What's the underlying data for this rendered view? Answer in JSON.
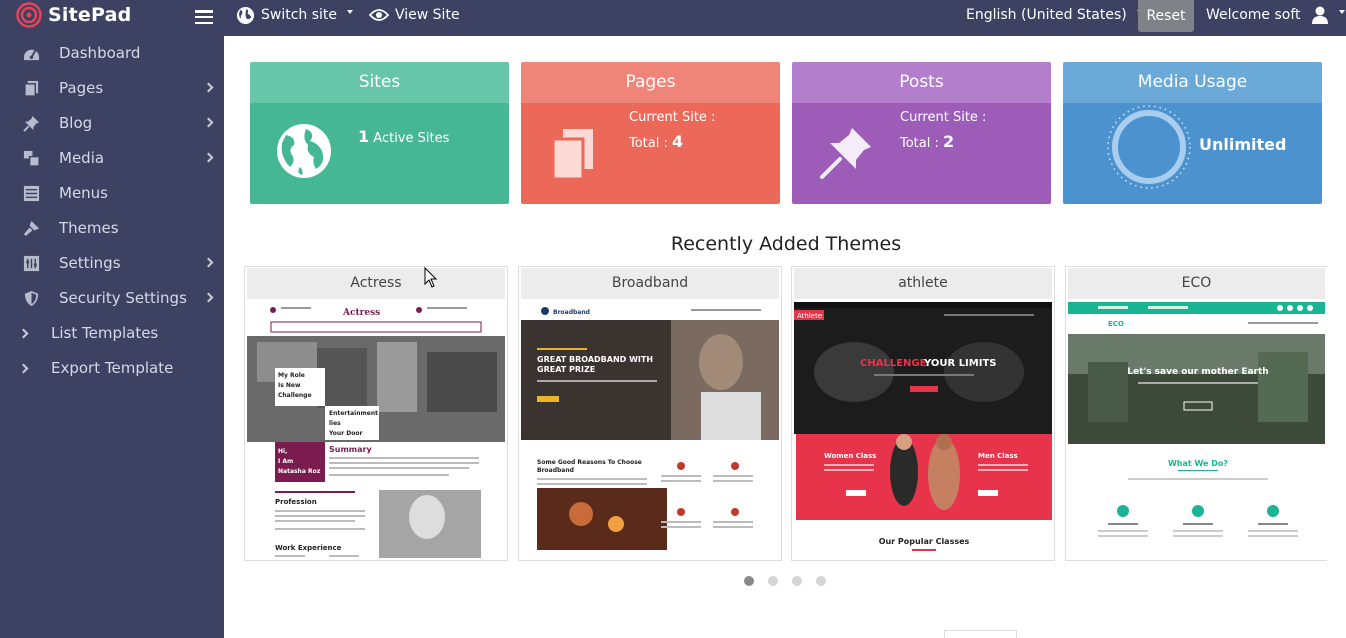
{
  "topbar": {
    "brand": "SitePad",
    "switch_site": "Switch site",
    "view_site": "View Site",
    "language": "English (United States)",
    "reset": "Reset",
    "welcome": "Welcome soft"
  },
  "sidebar": {
    "items": [
      {
        "label": "Dashboard",
        "icon": "dashboard-icon",
        "has_arrow": false
      },
      {
        "label": "Pages",
        "icon": "pages-icon",
        "has_arrow": true
      },
      {
        "label": "Blog",
        "icon": "pin-icon",
        "has_arrow": true
      },
      {
        "label": "Media",
        "icon": "media-icon",
        "has_arrow": true
      },
      {
        "label": "Menus",
        "icon": "menus-icon",
        "has_arrow": false
      },
      {
        "label": "Themes",
        "icon": "brush-icon",
        "has_arrow": false
      },
      {
        "label": "Settings",
        "icon": "settings-icon",
        "has_arrow": true
      },
      {
        "label": "Security Settings",
        "icon": "shield-icon",
        "has_arrow": true
      },
      {
        "label": "List Templates",
        "icon": "chevron-right-icon",
        "has_arrow": false
      },
      {
        "label": "Export Template",
        "icon": "chevron-right-icon",
        "has_arrow": false
      }
    ]
  },
  "cards": {
    "sites": {
      "title": "Sites",
      "count": "1",
      "label": "Active Sites",
      "color_head": "#67c5a8",
      "color_body": "#45b795"
    },
    "pages": {
      "title": "Pages",
      "current": "Current Site :",
      "total_label": "Total :",
      "total": "4",
      "color_head": "#ef8578",
      "color_body": "#ec6858"
    },
    "posts": {
      "title": "Posts",
      "current": "Current Site :",
      "total_label": "Total :",
      "total": "2",
      "color_head": "#b37fcc",
      "color_body": "#9c5cb8"
    },
    "media": {
      "title": "Media Usage",
      "value": "Unlimited",
      "color_head": "#6aa9d8",
      "color_body": "#4b92cf"
    }
  },
  "themes_section": {
    "title": "Recently Added Themes",
    "themes": [
      {
        "name": "Actress"
      },
      {
        "name": "Broadband"
      },
      {
        "name": "athlete"
      },
      {
        "name": "ECO"
      }
    ]
  },
  "previews": {
    "actress": {
      "brand": "Actress",
      "hero1": "My Role",
      "hero2": "Is New",
      "hero3": "Challenge",
      "ent1": "Entertainment",
      "ent2": "lies",
      "ent3": "Your Door",
      "hi1": "Hi,",
      "hi2": "I Am",
      "hi3": "Natasha Roz",
      "summary": "Summary",
      "profession": "Profession",
      "work": "Work Experience"
    },
    "broadband": {
      "brand": "Broadband",
      "hero1": "GREAT BROADBAND WITH",
      "hero2": "GREAT PRIZE",
      "reasons1": "Some Good Reasons To Choose",
      "reasons2": "Broadband"
    },
    "athlete": {
      "brand": "Athlete",
      "challenge": "CHALLENGE",
      "limits": "YOUR LIMITS",
      "women": "Women Class",
      "men": "Men Class",
      "popular": "Our Popular Classes"
    },
    "eco": {
      "brand": "ECO",
      "hero": "Let's save our mother Earth",
      "whatwedo": "What We Do?"
    }
  },
  "carousel": {
    "pages": 4,
    "active": 0
  }
}
